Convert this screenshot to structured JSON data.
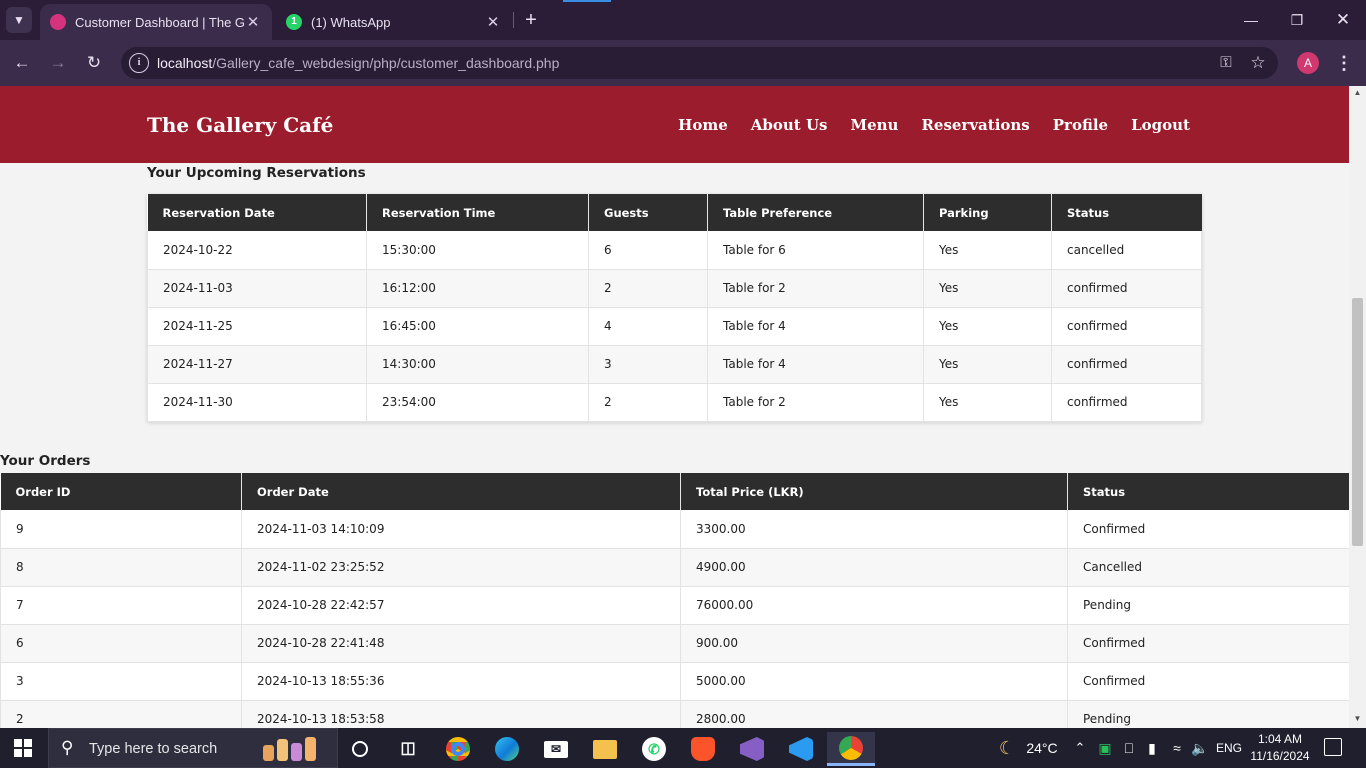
{
  "browser": {
    "tabs": [
      {
        "title": "Customer Dashboard | The Gallery Café",
        "active": true
      },
      {
        "title": "(1) WhatsApp",
        "active": false,
        "badge": "1"
      }
    ],
    "url_host": "localhost",
    "url_path": "/Gallery_cafe_webdesign/php/customer_dashboard.php",
    "profile_initial": "A",
    "icons": [
      "tab-search-icon",
      "back-icon",
      "forward-icon",
      "reload-icon",
      "site-info-icon",
      "password-key-icon",
      "bookmark-star-icon",
      "menu-dots-icon",
      "minimize-icon",
      "restore-icon",
      "close-icon"
    ]
  },
  "site": {
    "brand": "The Gallery Café",
    "nav": [
      "Home",
      "About Us",
      "Menu",
      "Reservations",
      "Profile",
      "Logout"
    ],
    "colors": {
      "header": "#9b1c2c",
      "table_header": "#2d2d2d"
    }
  },
  "reservations": {
    "title": "Your Upcoming Reservations",
    "columns": [
      "Reservation Date",
      "Reservation Time",
      "Guests",
      "Table Preference",
      "Parking",
      "Status"
    ],
    "rows": [
      [
        "2024-10-22",
        "15:30:00",
        "6",
        "Table for 6",
        "Yes",
        "cancelled"
      ],
      [
        "2024-11-03",
        "16:12:00",
        "2",
        "Table for 2",
        "Yes",
        "confirmed"
      ],
      [
        "2024-11-25",
        "16:45:00",
        "4",
        "Table for 4",
        "Yes",
        "confirmed"
      ],
      [
        "2024-11-27",
        "14:30:00",
        "3",
        "Table for 4",
        "Yes",
        "confirmed"
      ],
      [
        "2024-11-30",
        "23:54:00",
        "2",
        "Table for 2",
        "Yes",
        "confirmed"
      ]
    ]
  },
  "orders": {
    "title": "Your Orders",
    "columns": [
      "Order ID",
      "Order Date",
      "Total Price (LKR)",
      "Status"
    ],
    "rows": [
      [
        "9",
        "2024-11-03 14:10:09",
        "3300.00",
        "Confirmed"
      ],
      [
        "8",
        "2024-11-02 23:25:52",
        "4900.00",
        "Cancelled"
      ],
      [
        "7",
        "2024-10-28 22:42:57",
        "76000.00",
        "Pending"
      ],
      [
        "6",
        "2024-10-28 22:41:48",
        "900.00",
        "Confirmed"
      ],
      [
        "3",
        "2024-10-13 18:55:36",
        "5000.00",
        "Confirmed"
      ],
      [
        "2",
        "2024-10-13 18:53:58",
        "2800.00",
        "Pending"
      ]
    ]
  },
  "taskbar": {
    "search_placeholder": "Type here to search",
    "apps": [
      "cortana",
      "task-view",
      "chrome",
      "edge",
      "mail",
      "file-explorer",
      "whatsapp",
      "brave",
      "visual-studio",
      "vs-code",
      "chrome-profile"
    ],
    "weather": "24°C",
    "language": "ENG",
    "time": "1:04 AM",
    "date": "11/16/2024"
  }
}
